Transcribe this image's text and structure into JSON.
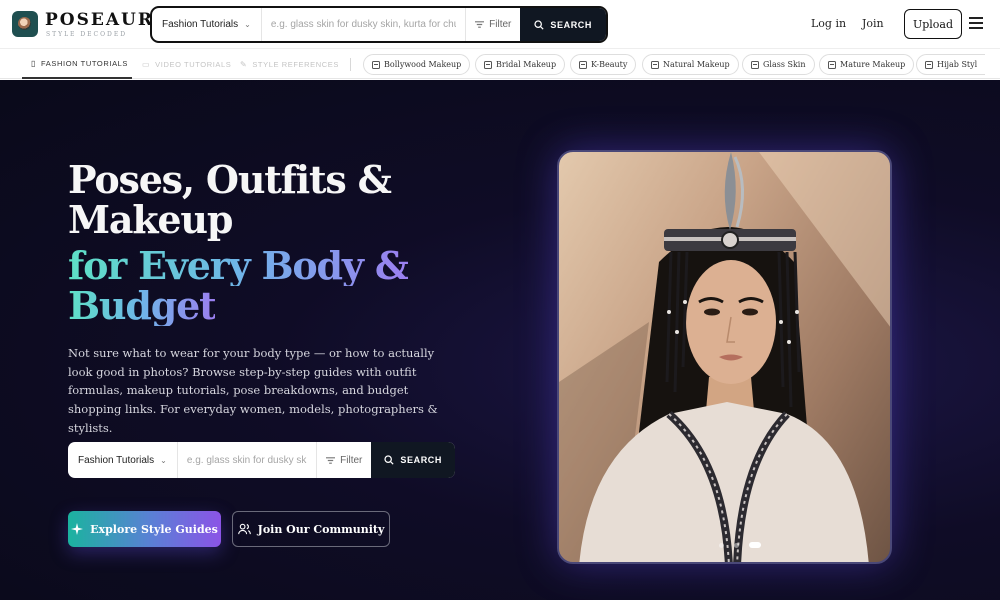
{
  "brand": {
    "name": "POSEAURA",
    "tagline": "STYLE DECODED"
  },
  "top_search": {
    "category": "Fashion Tutorials",
    "placeholder": "e.g. glass skin for dusky skin, kurta for chubby girls",
    "filter_label": "Filter",
    "search_label": "SEARCH"
  },
  "header": {
    "login_label": "Log in",
    "join_label": "Join",
    "upload_label": "Upload"
  },
  "tabs": [
    {
      "label": "FASHION TUTORIALS",
      "icon": "book-icon",
      "active": true
    },
    {
      "label": "VIDEO TUTORIALS",
      "icon": "video-icon",
      "active": false
    },
    {
      "label": "STYLE REFERENCES",
      "icon": "brush-icon",
      "active": false
    }
  ],
  "chips": [
    {
      "label": "Bollywood Makeup",
      "icon": "image-icon"
    },
    {
      "label": "Bridal Makeup",
      "icon": "image-icon"
    },
    {
      "label": "K-Beauty",
      "icon": "image-icon"
    },
    {
      "label": "Natural Makeup",
      "icon": "image-icon"
    },
    {
      "label": "Glass Skin",
      "icon": "image-icon"
    },
    {
      "label": "Mature Makeup",
      "icon": "image-icon"
    },
    {
      "label": "Hijab Styl",
      "icon": "image-icon"
    }
  ],
  "hero": {
    "title_line1": "Poses, Outfits &",
    "title_line2": "Makeup",
    "title_line3": "for Every Body &",
    "title_line4": "Budget",
    "description": "Not sure what to wear for your body type — or how to actually look good in photos? Browse step-by-step guides with outfit formulas, makeup tutorials, pose breakdowns, and budget shopping links. For everyday women, models, photographers & stylists.",
    "search": {
      "category": "Fashion Tutorials",
      "placeholder": "e.g. glass skin for dusky skin, kurta for chubby girls",
      "filter_label": "Filter",
      "search_label": "SEARCH"
    },
    "primary_cta": "Explore Style Guides",
    "secondary_cta": "Join Our Community",
    "carousel": {
      "slides": 3,
      "active_index": 2
    }
  },
  "colors": {
    "hero_bg": "#0f0c26",
    "search_button": "#101722",
    "gradient_start": "#1bb39f",
    "gradient_end": "#8b54e6"
  }
}
